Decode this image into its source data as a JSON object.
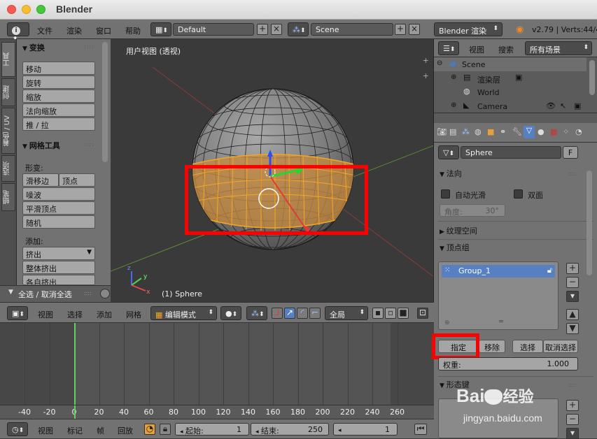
{
  "window": {
    "title": "Blender"
  },
  "menubar": {
    "menus": [
      "文件",
      "渲染",
      "窗口",
      "帮助"
    ],
    "layout_name": "Default",
    "scene_name": "Scene",
    "engine": "Blender 渲染",
    "version_info": "v2.79 | Verts:44/4"
  },
  "left_tabs": [
    "工具",
    "创建",
    "着色 / UV",
    "选项",
    "蜡笔"
  ],
  "tool_panel": {
    "transform_title": "变换",
    "transform_buttons": [
      "移动",
      "旋转",
      "缩放",
      "法向缩放",
      "推 / 拉"
    ],
    "mesh_tools_title": "网格工具",
    "deform_label": "形变:",
    "deform_buttons": [
      "滑移边",
      "顶点",
      "噪波",
      "平滑顶点",
      "随机"
    ],
    "add_label": "添加:",
    "add_buttons": [
      "挤出",
      "整体挤出",
      "各自挤出"
    ],
    "select_all_label": "全选 / 取消全选"
  },
  "viewport": {
    "view_label": "用户视图 (透视)",
    "object_label": "(1) Sphere"
  },
  "viewport_header": {
    "menus": [
      "视图",
      "选择",
      "添加",
      "网格"
    ],
    "mode": "编辑模式",
    "pivot": "全局"
  },
  "timeline": {
    "ticks": [
      "-40",
      "-20",
      "0",
      "20",
      "40",
      "60",
      "80",
      "100",
      "120",
      "140",
      "160",
      "180",
      "200",
      "220",
      "240",
      "260"
    ],
    "current_frame": 0,
    "header_menus": [
      "视图",
      "标记",
      "帧",
      "回放"
    ],
    "start_label": "起始:",
    "start_value": "1",
    "end_label": "结束:",
    "end_value": "250",
    "frame_value": "1"
  },
  "outliner": {
    "view_menu": "视图",
    "search_menu": "搜索",
    "filter": "所有场景",
    "items": [
      {
        "name": "Scene",
        "icon": "scene-icon"
      },
      {
        "name": "渲染层",
        "icon": "render-layer-icon"
      },
      {
        "name": "World",
        "icon": "world-icon"
      },
      {
        "name": "Camera",
        "icon": "camera-icon"
      }
    ]
  },
  "properties": {
    "mesh_name": "Sphere",
    "fake_user": "F",
    "normals_title": "法向",
    "auto_smooth": "自动光滑",
    "double_sided": "双面",
    "angle_label": "角度:",
    "angle_value": "30°",
    "texture_space_title": "纹理空间",
    "vertex_groups_title": "顶点组",
    "vertex_group_item": "Group_1",
    "assign": "指定",
    "remove": "移除",
    "select": "选择",
    "deselect": "取消选择",
    "weight_label": "权重:",
    "weight_value": "1.000",
    "shape_keys_title": "形态键"
  },
  "watermark": {
    "brand": "Bai",
    "suffix": "经验",
    "url": "jingyan.baidu.com"
  },
  "colors": {
    "selection_orange": "#f5a623",
    "highlight_red": "#ff0000",
    "selected_blue": "#5680c2"
  }
}
